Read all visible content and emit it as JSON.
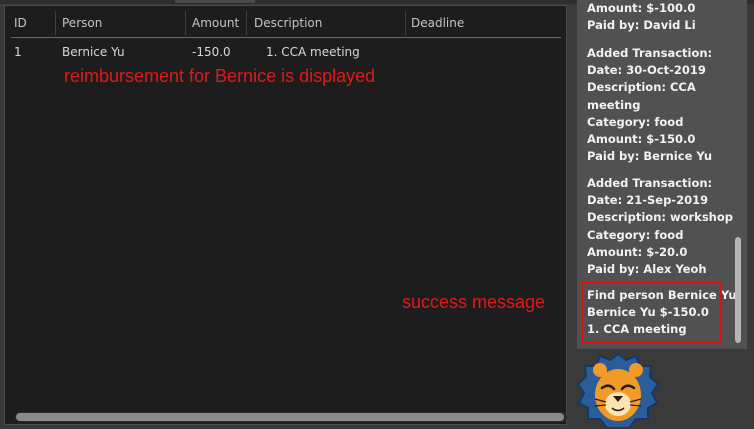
{
  "table": {
    "headers": [
      "ID",
      "Person",
      "Amount",
      "Description",
      "Deadline"
    ],
    "rows": [
      {
        "id": "1",
        "person": "Bernice Yu",
        "amount": "-150.0",
        "description": "1. CCA meeting",
        "deadline": ""
      }
    ]
  },
  "annotations": {
    "reimbursement": "reimbursement for Bernice is displayed",
    "success": "success message"
  },
  "log": {
    "partial_entry": [
      "Amount: $-100.0",
      "Paid by: David Li"
    ],
    "entry_cca": [
      "Added Transaction:",
      "Date: 30-Oct-2019",
      "Description: CCA",
      "meeting",
      "Category: food",
      "Amount: $-150.0",
      "Paid by: Bernice Yu"
    ],
    "entry_workshop": [
      "Added Transaction:",
      "Date: 21-Sep-2019",
      "Description: workshop",
      "Category: food",
      "Amount: $-20.0",
      "Paid by: Alex Yeoh"
    ],
    "result": [
      "Find person Bernice Yu",
      "Bernice Yu $-150.0",
      "1. CCA meeting"
    ]
  },
  "colors": {
    "annotation": "#e01a1a",
    "table_bg": "#1d1d1d",
    "log_bg": "#515151"
  },
  "mascot": {
    "icon": "lion-mascot-icon"
  }
}
